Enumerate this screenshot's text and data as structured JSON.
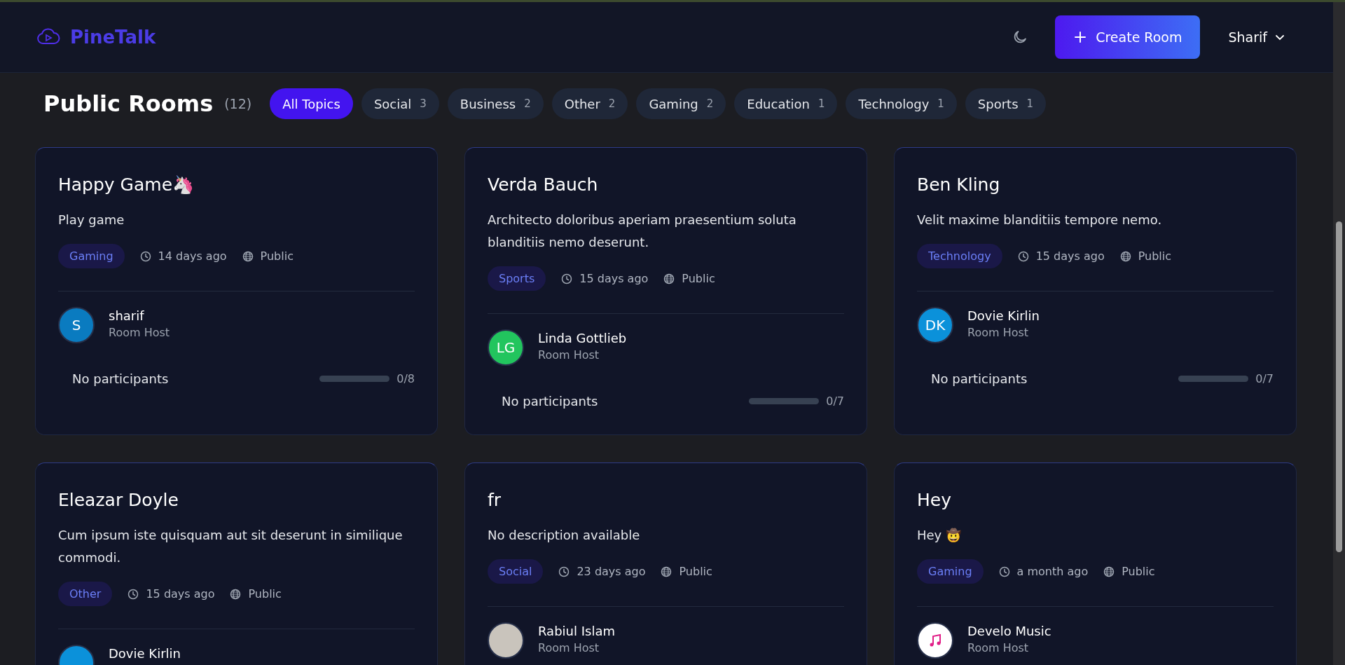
{
  "header": {
    "logo": "PineTalk",
    "create_button": "Create Room",
    "user": "Sharif"
  },
  "heading": {
    "title": "Public Rooms",
    "count": "(12)"
  },
  "filters": [
    {
      "label": "All Topics",
      "selected": true
    },
    {
      "label": "Social",
      "count": "3",
      "selected": false
    },
    {
      "label": "Business",
      "count": "2",
      "selected": false
    },
    {
      "label": "Other",
      "count": "2",
      "selected": false
    },
    {
      "label": "Gaming",
      "count": "2",
      "selected": false
    },
    {
      "label": "Education",
      "count": "1",
      "selected": false
    },
    {
      "label": "Technology",
      "count": "1",
      "selected": false
    },
    {
      "label": "Sports",
      "count": "1",
      "selected": false
    }
  ],
  "rooms": [
    {
      "title": "Happy Game🦄",
      "description": "Play game",
      "topic": "Gaming",
      "time": "14 days ago",
      "visibility": "Public",
      "host": {
        "kind": "initials",
        "initials": "S",
        "color": "#0a7bc0",
        "name": "sharif",
        "role": "Room Host"
      },
      "participants": "No participants",
      "level": 0,
      "capacity": "0/8"
    },
    {
      "title": "Verda Bauch",
      "description": "Architecto doloribus aperiam praesentium soluta blanditiis nemo deserunt.",
      "topic": "Sports",
      "time": "15 days ago",
      "visibility": "Public",
      "host": {
        "kind": "initials",
        "initials": "LG",
        "color": "#22c55e",
        "name": "Linda Gottlieb",
        "role": "Room Host"
      },
      "participants": "No participants",
      "level": 0,
      "capacity": "0/7"
    },
    {
      "title": "Ben Kling",
      "description": "Velit maxime blanditiis tempore nemo.",
      "topic": "Technology",
      "time": "15 days ago",
      "visibility": "Public",
      "host": {
        "kind": "initials",
        "initials": "DK",
        "color": "#0b91da",
        "name": "Dovie Kirlin",
        "role": "Room Host"
      },
      "participants": "No participants",
      "level": 0,
      "capacity": "0/7"
    },
    {
      "title": "Eleazar Doyle",
      "description": "Cum ipsum iste quisquam aut sit deserunt in similique commodi.",
      "topic": "Other",
      "time": "15 days ago",
      "visibility": "Public",
      "host": {
        "kind": "initials",
        "color": "#0b91da",
        "name": "Dovie Kirlin"
      }
    },
    {
      "title": "fr",
      "description": "No description available",
      "topic": "Social",
      "time": "23 days ago",
      "visibility": "Public",
      "host": {
        "kind": "photo",
        "name": "Rabiul Islam",
        "role": "Room Host"
      }
    },
    {
      "title": "Hey",
      "description": "Hey 🤠",
      "topic": "Gaming",
      "time": "a month ago",
      "visibility": "Public",
      "host": {
        "kind": "icon",
        "name": "Develo Music",
        "role": "Room Host"
      }
    }
  ]
}
